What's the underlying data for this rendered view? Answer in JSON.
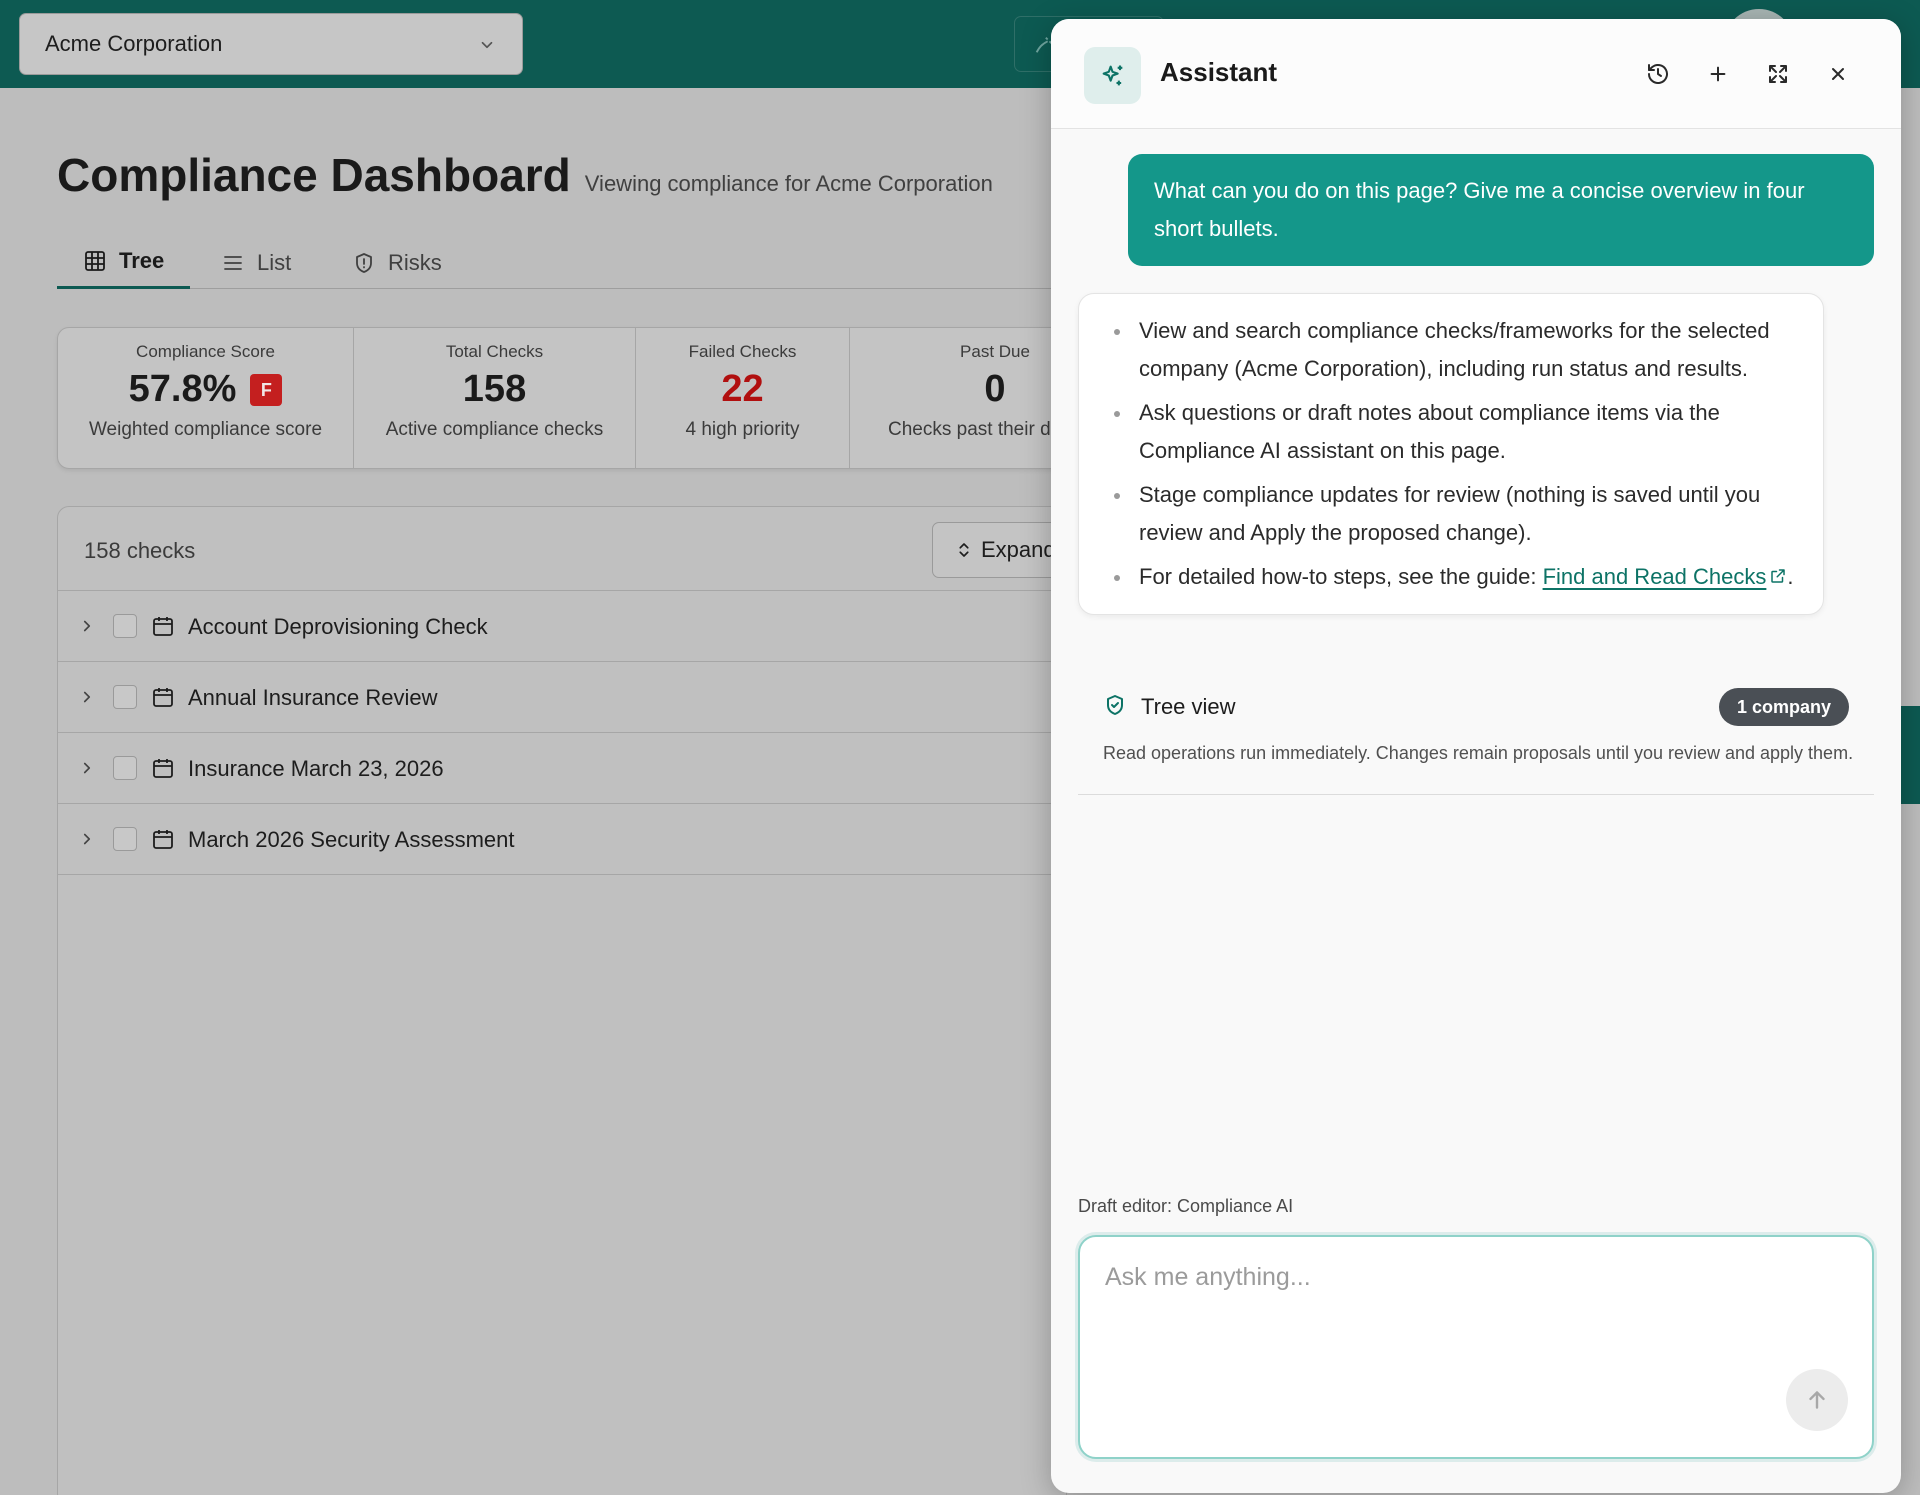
{
  "topbar": {
    "company_select": {
      "value": "Acme Corporation"
    }
  },
  "page": {
    "title": "Compliance Dashboard",
    "subtitle": "Viewing compliance for Acme Corporation"
  },
  "tabs": [
    {
      "label": "Tree",
      "icon": "grid-icon",
      "active": true
    },
    {
      "label": "List",
      "icon": "list-icon",
      "active": false
    },
    {
      "label": "Risks",
      "icon": "shield-alert-icon",
      "active": false
    }
  ],
  "stats": [
    {
      "label": "Compliance Score",
      "value": "57.8%",
      "grade": "F",
      "desc": "Weighted compliance score"
    },
    {
      "label": "Total Checks",
      "value": "158",
      "desc": "Active compliance checks"
    },
    {
      "label": "Failed Checks",
      "value": "22",
      "desc": "4 high priority",
      "color": "#b10f0f"
    },
    {
      "label": "Past Due",
      "value": "0",
      "desc": "Checks past their du"
    }
  ],
  "checks": {
    "count_label": "158 checks",
    "expand_label": "Expand",
    "rows": [
      {
        "label": "Account Deprovisioning Check"
      },
      {
        "label": "Annual Insurance Review"
      },
      {
        "label": "Insurance March 23, 2026"
      },
      {
        "label": "March 2026 Security Assessment"
      }
    ]
  },
  "assistant": {
    "title": "Assistant",
    "header_icons": [
      "history-icon",
      "plus-icon",
      "expand-icon",
      "close-icon"
    ],
    "user_message": "What can you do on this page? Give me a concise overview in four short bullets.",
    "bullets": [
      "View and search compliance checks/frameworks for the selected company (Acme Corporation), including run status and results.",
      "Ask questions or draft notes about compliance items via the Compliance AI assistant on this page.",
      "Stage compliance updates for review (nothing is saved until you review and Apply the proposed change)."
    ],
    "guide_prefix": "For detailed how-to steps, see the guide: ",
    "guide_link": "Find and Read Checks",
    "guide_suffix": ".",
    "tree_view": {
      "label": "Tree view",
      "badge": "1 company",
      "note": "Read operations run immediately. Changes remain proposals until you review and apply them."
    },
    "draft_label": "Draft editor: Compliance AI",
    "input_placeholder": "Ask me anything...",
    "accent_color": "#14978a"
  }
}
